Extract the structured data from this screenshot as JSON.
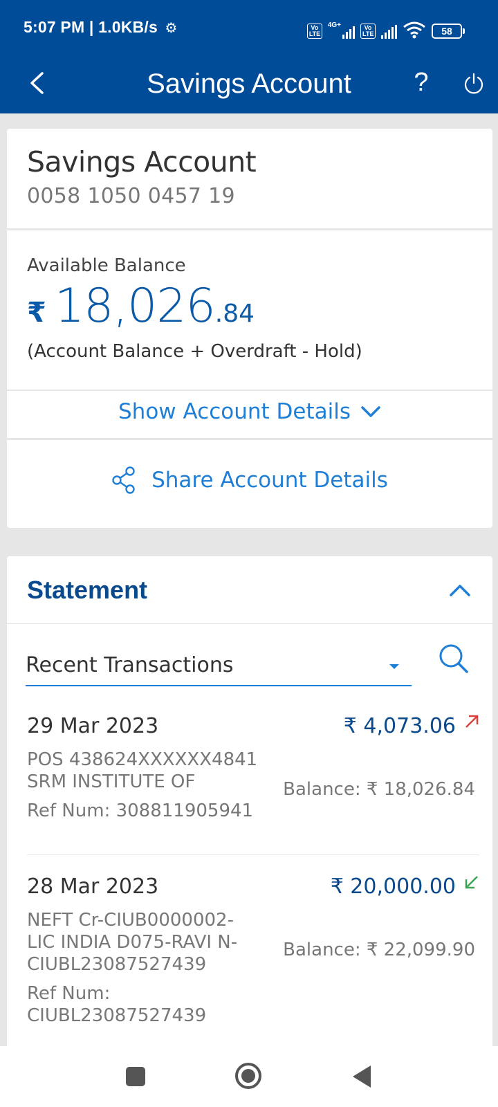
{
  "status_bar": {
    "time": "5:07 PM",
    "separator": "|",
    "speed": "1.0KB/s",
    "network_label": "4G+",
    "volte_label": "Vo LTE",
    "battery": "58",
    "icons": [
      "gear-icon",
      "volte-icon",
      "signal-icon",
      "wifi-icon",
      "battery-icon"
    ]
  },
  "header": {
    "title": "Savings Account",
    "help_label": "?",
    "icons": [
      "back-arrow-icon",
      "help-icon",
      "power-icon"
    ],
    "background_color": "#004c99"
  },
  "account": {
    "name": "Savings Account",
    "number": "0058 1050 0457 19"
  },
  "balance": {
    "label": "Available Balance",
    "currency_symbol": "₹",
    "integer_part": "18,026",
    "decimal_part": ".84",
    "note": "(Account Balance + Overdraft - Hold)"
  },
  "actions": {
    "show_details_label": "Show Account Details",
    "share_details_label": "Share Account Details",
    "icons": [
      "chevron-down-icon",
      "share-icon"
    ]
  },
  "statement": {
    "title": "Statement",
    "filter_value": "Recent Transactions",
    "icons": [
      "chevron-up-icon",
      "dropdown-caret-icon",
      "search-icon"
    ],
    "transactions": [
      {
        "date": "29 Mar 2023",
        "amount": "₹ 4,073.06",
        "direction": "debit",
        "desc_line1": "POS 438624XXXXXX4841",
        "desc_line2": "SRM INSTITUTE OF",
        "ref": "Ref Num: 308811905941",
        "balance": "Balance: ₹ 18,026.84"
      },
      {
        "date": "28 Mar 2023",
        "amount": "₹ 20,000.00",
        "direction": "credit",
        "desc_line1": "NEFT Cr-CIUB0000002-",
        "desc_line2": "LIC INDIA D075-RAVI N-",
        "desc_line3": "CIUBL23087527439",
        "ref_label": "Ref Num:",
        "ref_value": "CIUBL23087527439",
        "balance": "Balance: ₹ 22,099.90"
      }
    ]
  },
  "colors": {
    "brand_blue": "#004c99",
    "link_blue": "#1f7fd6",
    "debit_red": "#d9413a",
    "credit_green": "#3aa655"
  },
  "navigation": {
    "icons": [
      "recent-apps-icon",
      "home-icon",
      "back-icon"
    ]
  }
}
